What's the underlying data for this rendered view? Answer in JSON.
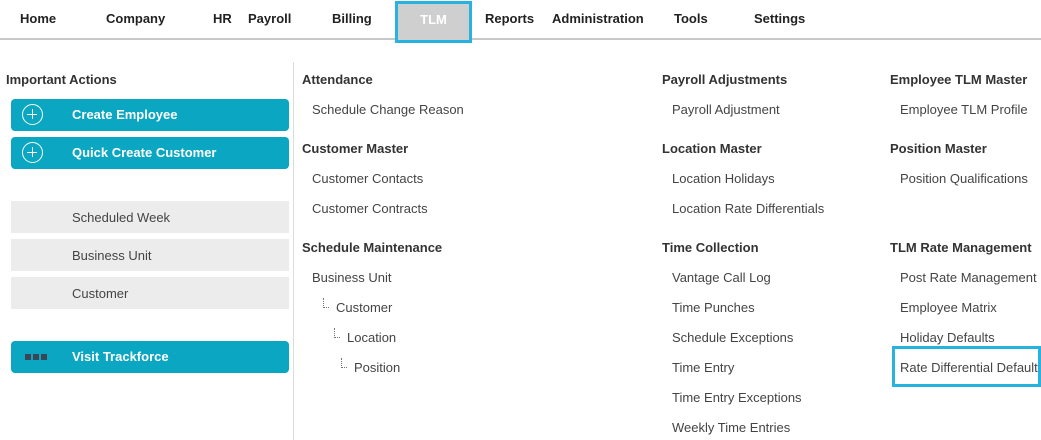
{
  "nav": {
    "items": [
      "Home",
      "Company",
      "HR",
      "Payroll",
      "Billing",
      "TLM",
      "Reports",
      "Administration",
      "Tools",
      "Settings"
    ],
    "active": "TLM"
  },
  "important_actions": {
    "title": "Important Actions",
    "create_employee": "Create Employee",
    "quick_create_customer": "Quick Create Customer",
    "quick_links": [
      "Scheduled Week",
      "Business Unit",
      "Customer"
    ],
    "visit_trackforce": "Visit Trackforce"
  },
  "menu": {
    "attendance": {
      "title": "Attendance",
      "items": [
        "Schedule Change Reason"
      ]
    },
    "customer_master": {
      "title": "Customer Master",
      "items": [
        "Customer Contacts",
        "Customer Contracts"
      ]
    },
    "schedule_maintenance": {
      "title": "Schedule Maintenance",
      "items": [
        "Business Unit",
        "Customer",
        "Location",
        "Position"
      ]
    },
    "payroll_adjustments": {
      "title": "Payroll Adjustments",
      "items": [
        "Payroll Adjustment"
      ]
    },
    "location_master": {
      "title": "Location Master",
      "items": [
        "Location Holidays",
        "Location Rate Differentials"
      ]
    },
    "time_collection": {
      "title": "Time Collection",
      "items": [
        "Vantage Call Log",
        "Time Punches",
        "Schedule Exceptions",
        "Time Entry",
        "Time Entry Exceptions",
        "Weekly Time Entries"
      ]
    },
    "employee_tlm_master": {
      "title": "Employee TLM Master",
      "items": [
        "Employee TLM Profile"
      ]
    },
    "position_master": {
      "title": "Position Master",
      "items": [
        "Position Qualifications"
      ]
    },
    "tlm_rate_management": {
      "title": "TLM Rate Management",
      "items": [
        "Post Rate Management",
        "Employee Matrix",
        "Holiday Defaults",
        "Rate Differential Default"
      ]
    }
  },
  "colors": {
    "accent": "#0aa6c2",
    "highlight": "#27b2e0",
    "active_tab_bg": "#cfcfcf"
  },
  "icons": {
    "add": "plus-circle-icon",
    "trackforce": "trackforce-logo-icon"
  }
}
